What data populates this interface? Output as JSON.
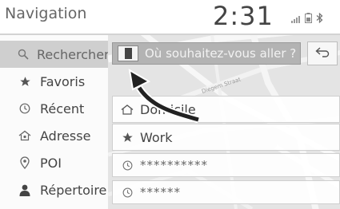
{
  "header": {
    "title": "Navigation",
    "clock": "2:31"
  },
  "sidebar": {
    "items": [
      {
        "label": "Rechercher",
        "icon": "search-icon",
        "active": true
      },
      {
        "label": "Favoris",
        "icon": "star-icon"
      },
      {
        "label": "Récent",
        "icon": "clock-icon"
      },
      {
        "label": "Adresse",
        "icon": "address-icon"
      },
      {
        "label": "POI",
        "icon": "pin-icon"
      },
      {
        "label": "Répertoire",
        "icon": "person-icon"
      }
    ]
  },
  "search": {
    "placeholder": "Où souhaitez-vous aller ?"
  },
  "results": [
    {
      "label": "Domicile",
      "icon": "home-icon"
    },
    {
      "label": "Work",
      "icon": "star-icon"
    },
    {
      "label": "**********",
      "icon": "clock-icon"
    },
    {
      "label": "******",
      "icon": "clock-icon"
    }
  ],
  "map": {
    "street_label": "Diegem Straat"
  },
  "colors": {
    "search_bar": "#b3b3b3",
    "sidebar_active": "#cfcfcf",
    "map_bg": "#e4e4e4"
  }
}
